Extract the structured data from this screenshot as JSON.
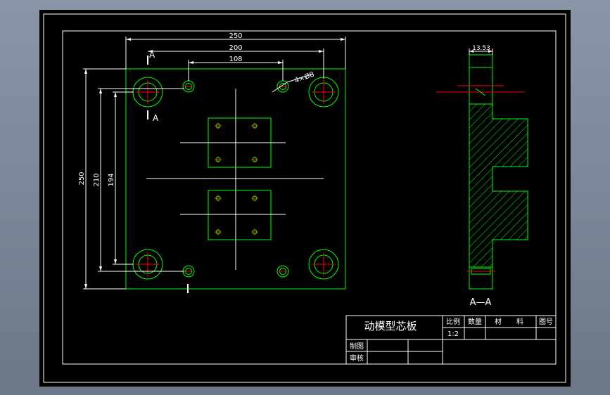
{
  "drawing": {
    "dimensions": {
      "overall_width": "250",
      "bolt_spacing": "200",
      "pin_spacing": "108",
      "overall_height": "250",
      "vertical_210": "210",
      "vertical_194": "194",
      "hole_callout": "4×Ø8",
      "side_thickness": "13.53"
    },
    "section": {
      "cut_label_top": "A",
      "cut_label_bottom": "A",
      "view_label": "A—A"
    },
    "title_block": {
      "part_name": "动模型芯板",
      "scale_label": "比例",
      "scale_value": "1:2",
      "qty_label": "数量",
      "material_char1": "材",
      "material_char2": "料",
      "drawing_no_label": "图号",
      "drawn_by_label": "制图",
      "checked_by_label": "审核"
    }
  },
  "colors": {
    "outline": "#00ff00",
    "centerline": "#ff0000",
    "dimension": "#ffffff",
    "title_text": "#ffffff",
    "background": "#000000"
  }
}
